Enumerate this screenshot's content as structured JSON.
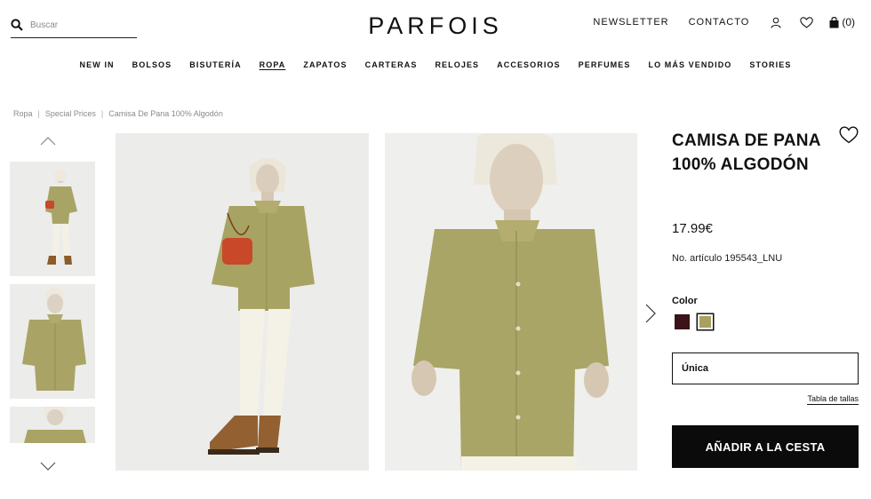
{
  "header": {
    "search_placeholder": "Buscar",
    "logo": "PARFOIS",
    "newsletter": "NEWSLETTER",
    "contact": "CONTACTO",
    "cart_count": "(0)"
  },
  "nav": {
    "items": [
      "NEW IN",
      "BOLSOS",
      "BISUTERÍA",
      "ROPA",
      "ZAPATOS",
      "CARTERAS",
      "RELOJES",
      "ACCESORIOS",
      "PERFUMES",
      "LO MÁS VENDIDO",
      "STORIES"
    ],
    "active": "ROPA"
  },
  "breadcrumb": {
    "items": [
      "Ropa",
      "Special Prices",
      "Camisa De Pana 100% Algodón"
    ],
    "separator": "|"
  },
  "product": {
    "title": "CAMISA DE PANA 100% ALGODÓN",
    "price": "17.99€",
    "article": "No. artículo 195543_LNU",
    "color_label": "Color",
    "colors": [
      "#3a1418",
      "#a7a161"
    ],
    "selected_color": "#a7a161",
    "size": "Única",
    "size_table": "Tabla de tallas",
    "add_to_cart": "AÑADIR A LA CESTA"
  },
  "icons": {
    "search": "search-icon",
    "user": "user-icon",
    "wishlist": "heart-icon",
    "cart": "bag-icon",
    "prev": "chevron-up-icon",
    "next": "chevron-down-icon",
    "gallery_next": "chevron-right-icon"
  }
}
